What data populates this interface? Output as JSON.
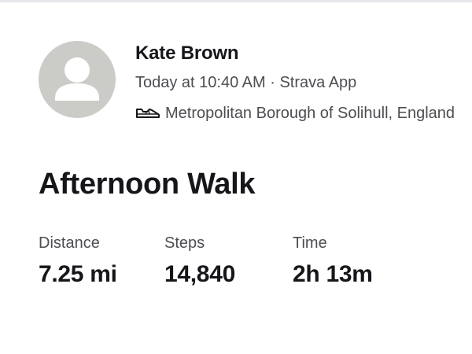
{
  "athlete": {
    "name": "Kate Brown",
    "avatar_icon": "person-placeholder-icon"
  },
  "activity": {
    "meta": "Today at 10:40 AM · Strava App",
    "sport_icon": "shoe-icon",
    "location": "Metropolitan Borough of Solihull, England",
    "title": "Afternoon Walk"
  },
  "stats": [
    {
      "label": "Distance",
      "value": "7.25 mi"
    },
    {
      "label": "Steps",
      "value": "14,840"
    },
    {
      "label": "Time",
      "value": "2h 13m"
    }
  ],
  "colors": {
    "text_primary": "#16161a",
    "text_secondary": "#4d4d52",
    "avatar_bg": "#cbcbc8"
  }
}
